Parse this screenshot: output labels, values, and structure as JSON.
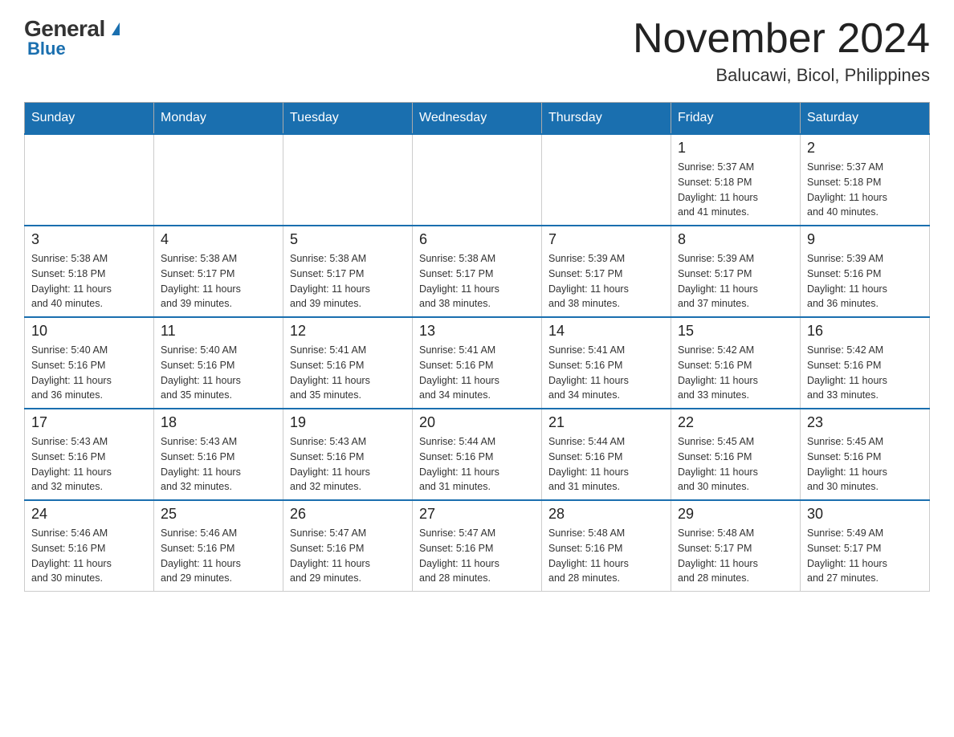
{
  "logo": {
    "general": "General",
    "triangle": "▶",
    "blue": "Blue"
  },
  "header": {
    "month": "November 2024",
    "location": "Balucawi, Bicol, Philippines"
  },
  "weekdays": [
    "Sunday",
    "Monday",
    "Tuesday",
    "Wednesday",
    "Thursday",
    "Friday",
    "Saturday"
  ],
  "weeks": [
    [
      {
        "day": "",
        "info": ""
      },
      {
        "day": "",
        "info": ""
      },
      {
        "day": "",
        "info": ""
      },
      {
        "day": "",
        "info": ""
      },
      {
        "day": "",
        "info": ""
      },
      {
        "day": "1",
        "info": "Sunrise: 5:37 AM\nSunset: 5:18 PM\nDaylight: 11 hours\nand 41 minutes."
      },
      {
        "day": "2",
        "info": "Sunrise: 5:37 AM\nSunset: 5:18 PM\nDaylight: 11 hours\nand 40 minutes."
      }
    ],
    [
      {
        "day": "3",
        "info": "Sunrise: 5:38 AM\nSunset: 5:18 PM\nDaylight: 11 hours\nand 40 minutes."
      },
      {
        "day": "4",
        "info": "Sunrise: 5:38 AM\nSunset: 5:17 PM\nDaylight: 11 hours\nand 39 minutes."
      },
      {
        "day": "5",
        "info": "Sunrise: 5:38 AM\nSunset: 5:17 PM\nDaylight: 11 hours\nand 39 minutes."
      },
      {
        "day": "6",
        "info": "Sunrise: 5:38 AM\nSunset: 5:17 PM\nDaylight: 11 hours\nand 38 minutes."
      },
      {
        "day": "7",
        "info": "Sunrise: 5:39 AM\nSunset: 5:17 PM\nDaylight: 11 hours\nand 38 minutes."
      },
      {
        "day": "8",
        "info": "Sunrise: 5:39 AM\nSunset: 5:17 PM\nDaylight: 11 hours\nand 37 minutes."
      },
      {
        "day": "9",
        "info": "Sunrise: 5:39 AM\nSunset: 5:16 PM\nDaylight: 11 hours\nand 36 minutes."
      }
    ],
    [
      {
        "day": "10",
        "info": "Sunrise: 5:40 AM\nSunset: 5:16 PM\nDaylight: 11 hours\nand 36 minutes."
      },
      {
        "day": "11",
        "info": "Sunrise: 5:40 AM\nSunset: 5:16 PM\nDaylight: 11 hours\nand 35 minutes."
      },
      {
        "day": "12",
        "info": "Sunrise: 5:41 AM\nSunset: 5:16 PM\nDaylight: 11 hours\nand 35 minutes."
      },
      {
        "day": "13",
        "info": "Sunrise: 5:41 AM\nSunset: 5:16 PM\nDaylight: 11 hours\nand 34 minutes."
      },
      {
        "day": "14",
        "info": "Sunrise: 5:41 AM\nSunset: 5:16 PM\nDaylight: 11 hours\nand 34 minutes."
      },
      {
        "day": "15",
        "info": "Sunrise: 5:42 AM\nSunset: 5:16 PM\nDaylight: 11 hours\nand 33 minutes."
      },
      {
        "day": "16",
        "info": "Sunrise: 5:42 AM\nSunset: 5:16 PM\nDaylight: 11 hours\nand 33 minutes."
      }
    ],
    [
      {
        "day": "17",
        "info": "Sunrise: 5:43 AM\nSunset: 5:16 PM\nDaylight: 11 hours\nand 32 minutes."
      },
      {
        "day": "18",
        "info": "Sunrise: 5:43 AM\nSunset: 5:16 PM\nDaylight: 11 hours\nand 32 minutes."
      },
      {
        "day": "19",
        "info": "Sunrise: 5:43 AM\nSunset: 5:16 PM\nDaylight: 11 hours\nand 32 minutes."
      },
      {
        "day": "20",
        "info": "Sunrise: 5:44 AM\nSunset: 5:16 PM\nDaylight: 11 hours\nand 31 minutes."
      },
      {
        "day": "21",
        "info": "Sunrise: 5:44 AM\nSunset: 5:16 PM\nDaylight: 11 hours\nand 31 minutes."
      },
      {
        "day": "22",
        "info": "Sunrise: 5:45 AM\nSunset: 5:16 PM\nDaylight: 11 hours\nand 30 minutes."
      },
      {
        "day": "23",
        "info": "Sunrise: 5:45 AM\nSunset: 5:16 PM\nDaylight: 11 hours\nand 30 minutes."
      }
    ],
    [
      {
        "day": "24",
        "info": "Sunrise: 5:46 AM\nSunset: 5:16 PM\nDaylight: 11 hours\nand 30 minutes."
      },
      {
        "day": "25",
        "info": "Sunrise: 5:46 AM\nSunset: 5:16 PM\nDaylight: 11 hours\nand 29 minutes."
      },
      {
        "day": "26",
        "info": "Sunrise: 5:47 AM\nSunset: 5:16 PM\nDaylight: 11 hours\nand 29 minutes."
      },
      {
        "day": "27",
        "info": "Sunrise: 5:47 AM\nSunset: 5:16 PM\nDaylight: 11 hours\nand 28 minutes."
      },
      {
        "day": "28",
        "info": "Sunrise: 5:48 AM\nSunset: 5:16 PM\nDaylight: 11 hours\nand 28 minutes."
      },
      {
        "day": "29",
        "info": "Sunrise: 5:48 AM\nSunset: 5:17 PM\nDaylight: 11 hours\nand 28 minutes."
      },
      {
        "day": "30",
        "info": "Sunrise: 5:49 AM\nSunset: 5:17 PM\nDaylight: 11 hours\nand 27 minutes."
      }
    ]
  ]
}
